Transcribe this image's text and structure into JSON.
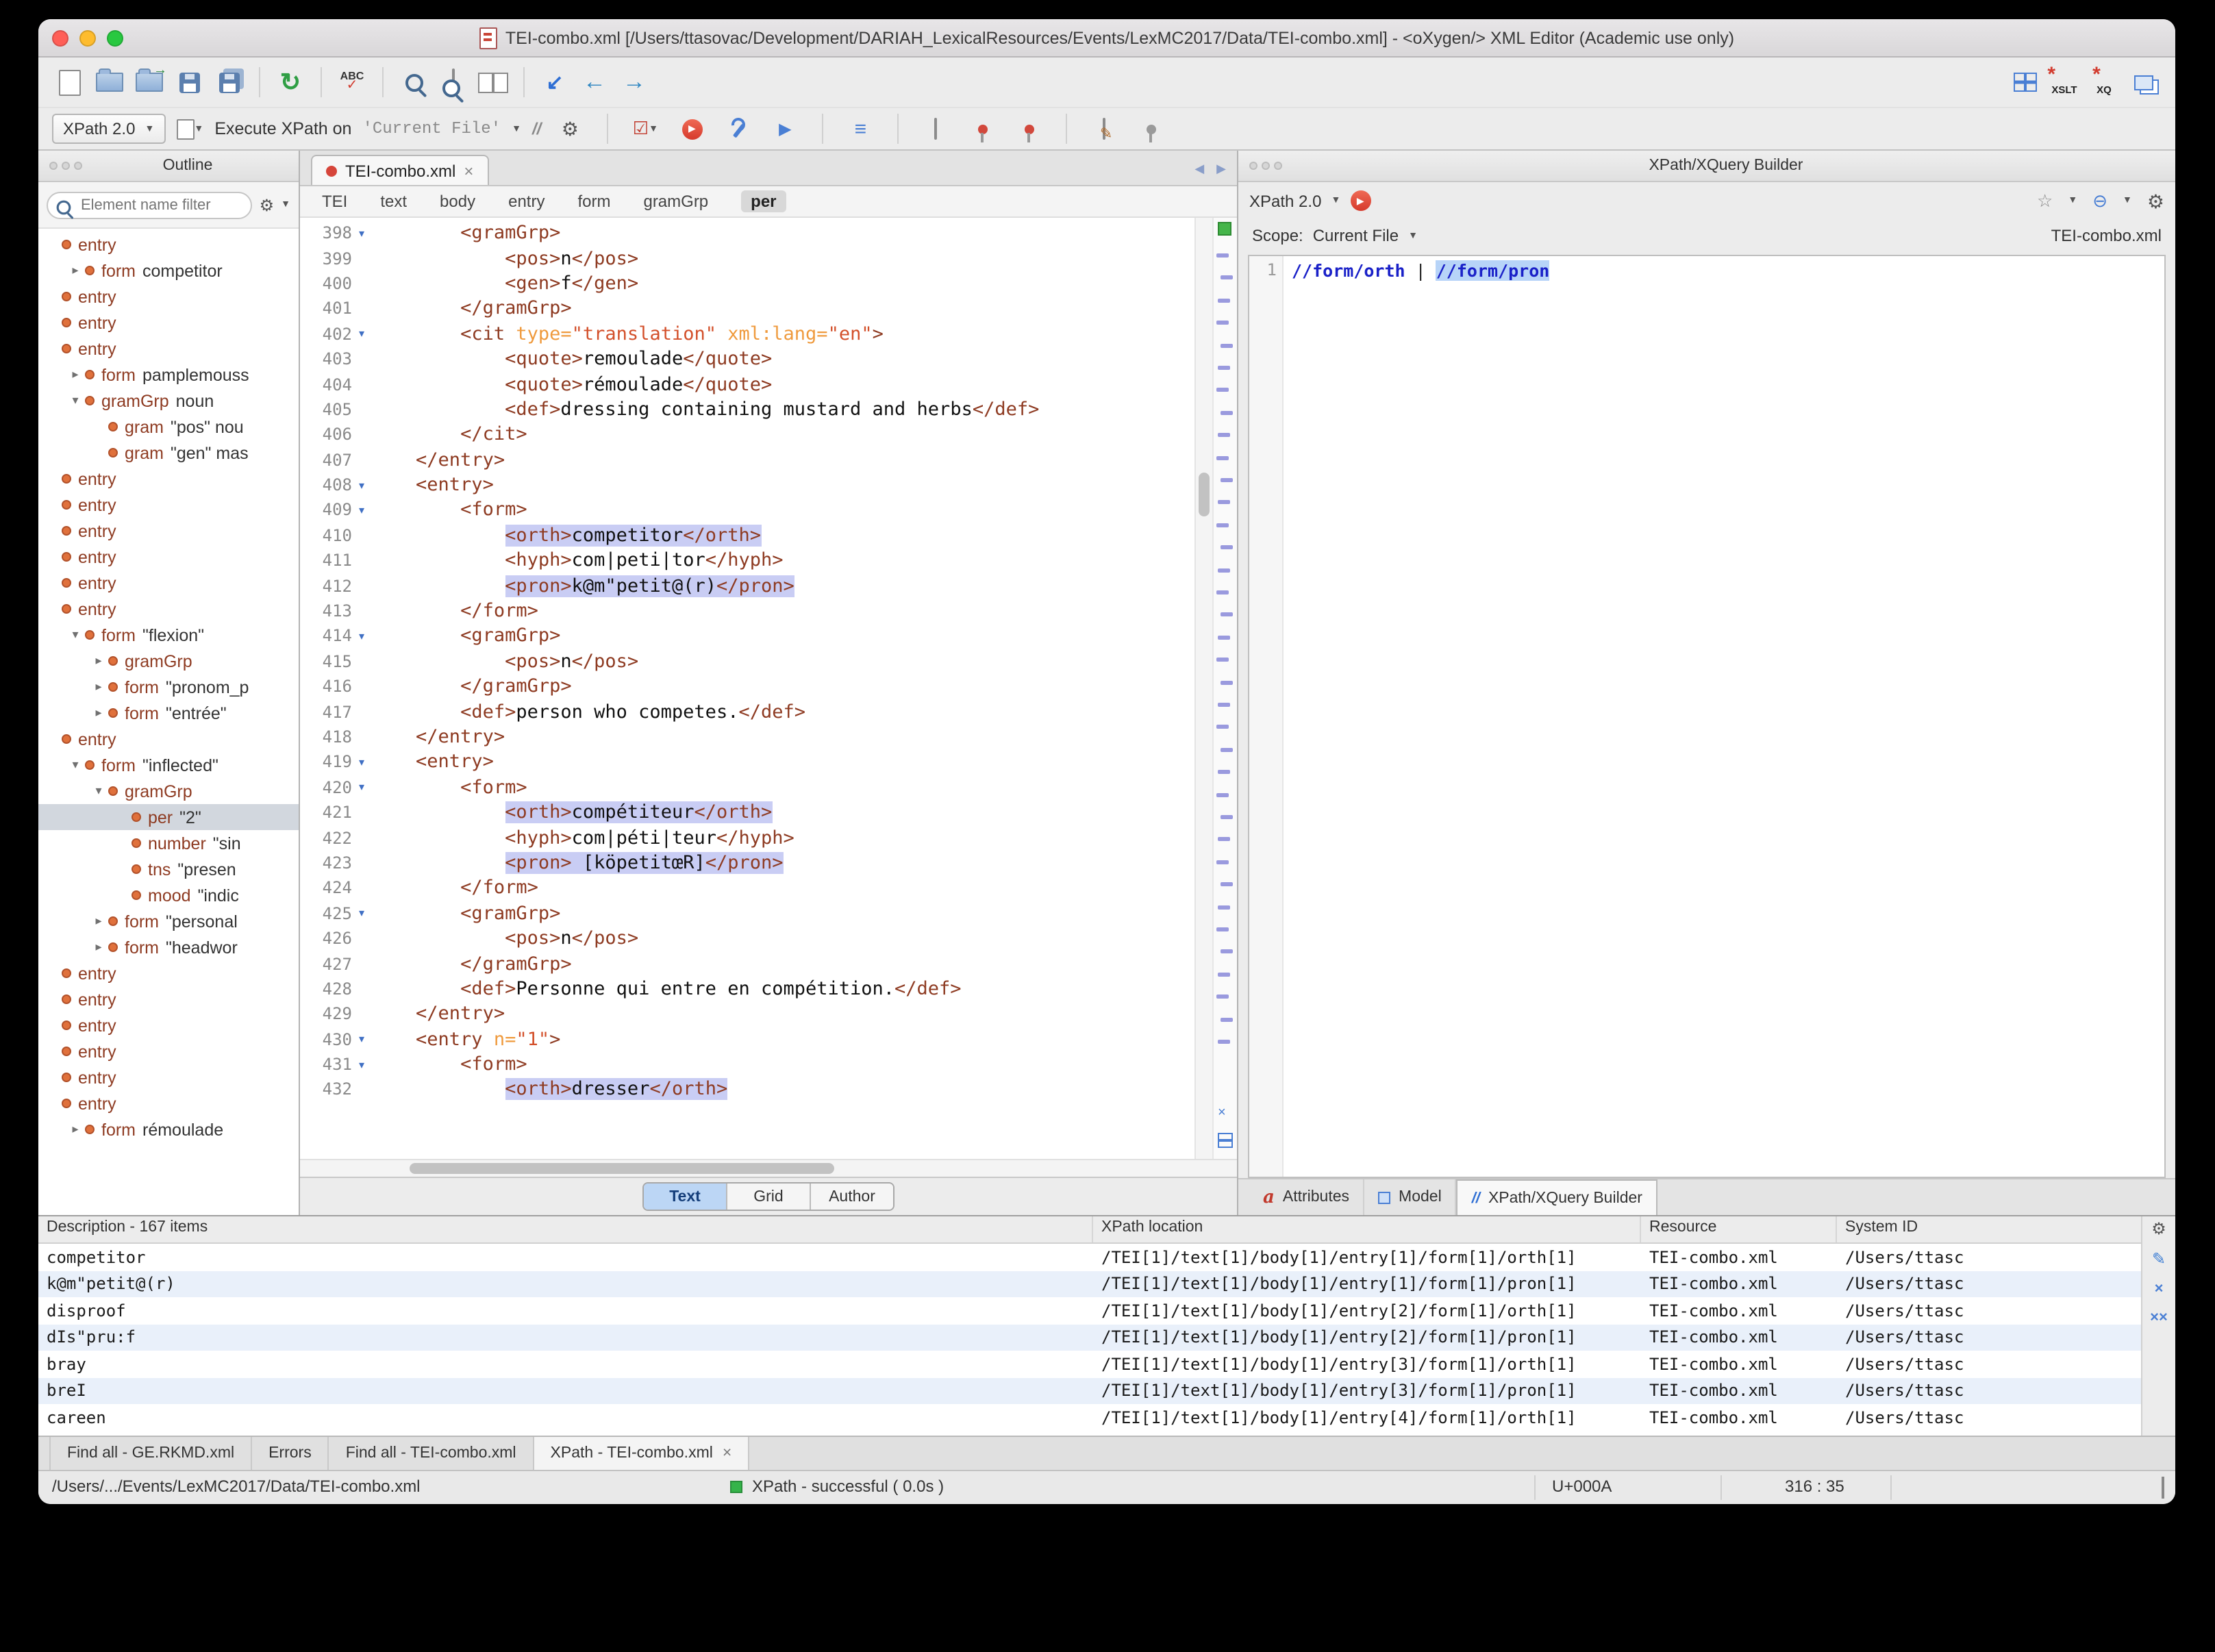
{
  "window": {
    "title": "TEI-combo.xml [/Users/ttasovac/Development/DARIAH_LexicalResources/Events/LexMC2017/Data/TEI-combo.xml] - <oXygen/> XML Editor (Academic use only)"
  },
  "toolbar": {
    "spell": "ABC",
    "xslt": "XSLT",
    "xq": "XQ"
  },
  "xpath_toolbar": {
    "version": "XPath 2.0",
    "execute_label": "Execute XPath on",
    "scope": "'Current File'",
    "xpath_glyph": "//"
  },
  "outline": {
    "title": "Outline",
    "filter_placeholder": "Element name filter",
    "items": [
      {
        "l": 0,
        "a": "",
        "n": "entry",
        "x": ""
      },
      {
        "l": 1,
        "a": "r",
        "n": "form",
        "x": "competitor"
      },
      {
        "l": 0,
        "a": "",
        "n": "entry",
        "x": ""
      },
      {
        "l": 0,
        "a": "",
        "n": "entry",
        "x": ""
      },
      {
        "l": 0,
        "a": "",
        "n": "entry",
        "x": ""
      },
      {
        "l": 1,
        "a": "r",
        "n": "form",
        "x": "pamplemouss"
      },
      {
        "l": 1,
        "a": "d",
        "n": "gramGrp",
        "x": "noun"
      },
      {
        "l": 2,
        "a": "",
        "n": "gram",
        "x": "\"pos\" nou"
      },
      {
        "l": 2,
        "a": "",
        "n": "gram",
        "x": "\"gen\" mas"
      },
      {
        "l": 0,
        "a": "",
        "n": "entry",
        "x": ""
      },
      {
        "l": 0,
        "a": "",
        "n": "entry",
        "x": ""
      },
      {
        "l": 0,
        "a": "",
        "n": "entry",
        "x": ""
      },
      {
        "l": 0,
        "a": "",
        "n": "entry",
        "x": ""
      },
      {
        "l": 0,
        "a": "",
        "n": "entry",
        "x": ""
      },
      {
        "l": 0,
        "a": "",
        "n": "entry",
        "x": ""
      },
      {
        "l": 1,
        "a": "d",
        "n": "form",
        "x": "\"flexion\""
      },
      {
        "l": 2,
        "a": "r",
        "n": "gramGrp",
        "x": ""
      },
      {
        "l": 2,
        "a": "r",
        "n": "form",
        "x": "\"pronom_p"
      },
      {
        "l": 2,
        "a": "r",
        "n": "form",
        "x": "\"entrée\""
      },
      {
        "l": 0,
        "a": "",
        "n": "entry",
        "x": ""
      },
      {
        "l": 1,
        "a": "d",
        "n": "form",
        "x": "\"inflected\""
      },
      {
        "l": 2,
        "a": "d",
        "n": "gramGrp",
        "x": ""
      },
      {
        "l": 3,
        "a": "",
        "n": "per",
        "x": "\"2\"",
        "sel": true
      },
      {
        "l": 3,
        "a": "",
        "n": "number",
        "x": "\"sin"
      },
      {
        "l": 3,
        "a": "",
        "n": "tns",
        "x": "\"presen"
      },
      {
        "l": 3,
        "a": "",
        "n": "mood",
        "x": "\"indic"
      },
      {
        "l": 2,
        "a": "r",
        "n": "form",
        "x": "\"personal"
      },
      {
        "l": 2,
        "a": "r",
        "n": "form",
        "x": "\"headwor"
      },
      {
        "l": 0,
        "a": "",
        "n": "entry",
        "x": ""
      },
      {
        "l": 0,
        "a": "",
        "n": "entry",
        "x": ""
      },
      {
        "l": 0,
        "a": "",
        "n": "entry",
        "x": ""
      },
      {
        "l": 0,
        "a": "",
        "n": "entry",
        "x": ""
      },
      {
        "l": 0,
        "a": "",
        "n": "entry",
        "x": ""
      },
      {
        "l": 0,
        "a": "",
        "n": "entry",
        "x": ""
      },
      {
        "l": 1,
        "a": "r",
        "n": "form",
        "x": "rémoulade"
      }
    ]
  },
  "editor": {
    "tab": "TEI-combo.xml",
    "breadcrumb": [
      "TEI",
      "text",
      "body",
      "entry",
      "form",
      "gramGrp",
      "per"
    ],
    "breadcrumb_active": "per",
    "modes": [
      "Text",
      "Grid",
      "Author"
    ],
    "active_mode": "Text",
    "lines": [
      {
        "n": 398,
        "fold": true,
        "ind": 8,
        "segs": [
          [
            "tag",
            "<gramGrp>"
          ]
        ]
      },
      {
        "n": 399,
        "ind": 12,
        "segs": [
          [
            "tag",
            "<pos>"
          ],
          [
            "txt",
            "n"
          ],
          [
            "tag",
            "</pos>"
          ]
        ]
      },
      {
        "n": 400,
        "ind": 12,
        "segs": [
          [
            "tag",
            "<gen>"
          ],
          [
            "txt",
            "f"
          ],
          [
            "tag",
            "</gen>"
          ]
        ]
      },
      {
        "n": 401,
        "ind": 8,
        "segs": [
          [
            "tag",
            "</gramGrp>"
          ]
        ]
      },
      {
        "n": 402,
        "fold": true,
        "ind": 8,
        "segs": [
          [
            "tag",
            "<cit"
          ],
          [
            "attr",
            " type="
          ],
          [
            "aval",
            "\"translation\""
          ],
          [
            "attr",
            " xml:lang="
          ],
          [
            "aval",
            "\"en\""
          ],
          [
            "tag",
            ">"
          ]
        ]
      },
      {
        "n": 403,
        "ind": 12,
        "segs": [
          [
            "tag",
            "<quote>"
          ],
          [
            "txt",
            "remoulade"
          ],
          [
            "tag",
            "</quote>"
          ]
        ]
      },
      {
        "n": 404,
        "ind": 12,
        "segs": [
          [
            "tag",
            "<quote>"
          ],
          [
            "txt",
            "rémoulade"
          ],
          [
            "tag",
            "</quote>"
          ]
        ]
      },
      {
        "n": 405,
        "ind": 12,
        "segs": [
          [
            "tag",
            "<def>"
          ],
          [
            "txt",
            "dressing containing mustard and herbs"
          ],
          [
            "tag",
            "</def>"
          ]
        ]
      },
      {
        "n": 406,
        "ind": 8,
        "segs": [
          [
            "tag",
            "</cit>"
          ]
        ]
      },
      {
        "n": 407,
        "ind": 4,
        "segs": [
          [
            "tag",
            "</entry>"
          ]
        ]
      },
      {
        "n": 408,
        "fold": true,
        "ind": 4,
        "segs": [
          [
            "tag",
            "<entry>"
          ]
        ]
      },
      {
        "n": 409,
        "fold": true,
        "ind": 8,
        "segs": [
          [
            "tag",
            "<form>"
          ]
        ]
      },
      {
        "n": 410,
        "ind": 12,
        "segs": [
          [
            "tag",
            "<orth>",
            1
          ],
          [
            "txt",
            "competitor",
            1
          ],
          [
            "tag",
            "</orth>",
            1
          ]
        ]
      },
      {
        "n": 411,
        "ind": 12,
        "segs": [
          [
            "tag",
            "<hyph>"
          ],
          [
            "txt",
            "com|peti|tor"
          ],
          [
            "tag",
            "</hyph>"
          ]
        ]
      },
      {
        "n": 412,
        "ind": 12,
        "segs": [
          [
            "tag",
            "<pron>",
            1
          ],
          [
            "txt",
            "k@m\"petit@(r)",
            1
          ],
          [
            "tag",
            "</pron>",
            1
          ]
        ]
      },
      {
        "n": 413,
        "ind": 8,
        "segs": [
          [
            "tag",
            "</form>"
          ]
        ]
      },
      {
        "n": 414,
        "fold": true,
        "ind": 8,
        "segs": [
          [
            "tag",
            "<gramGrp>"
          ]
        ]
      },
      {
        "n": 415,
        "ind": 12,
        "segs": [
          [
            "tag",
            "<pos>"
          ],
          [
            "txt",
            "n"
          ],
          [
            "tag",
            "</pos>"
          ]
        ]
      },
      {
        "n": 416,
        "ind": 8,
        "segs": [
          [
            "tag",
            "</gramGrp>"
          ]
        ]
      },
      {
        "n": 417,
        "ind": 8,
        "segs": [
          [
            "tag",
            "<def>"
          ],
          [
            "txt",
            "person who competes."
          ],
          [
            "tag",
            "</def>"
          ]
        ]
      },
      {
        "n": 418,
        "ind": 4,
        "segs": [
          [
            "tag",
            "</entry>"
          ]
        ]
      },
      {
        "n": 419,
        "fold": true,
        "ind": 4,
        "segs": [
          [
            "tag",
            "<entry>"
          ]
        ]
      },
      {
        "n": 420,
        "fold": true,
        "ind": 8,
        "segs": [
          [
            "tag",
            "<form>"
          ]
        ]
      },
      {
        "n": 421,
        "ind": 12,
        "segs": [
          [
            "tag",
            "<orth>",
            1
          ],
          [
            "txt",
            "compétiteur",
            1
          ],
          [
            "tag",
            "</orth>",
            1
          ]
        ]
      },
      {
        "n": 422,
        "ind": 12,
        "segs": [
          [
            "tag",
            "<hyph>"
          ],
          [
            "txt",
            "com|péti|teur"
          ],
          [
            "tag",
            "</hyph>"
          ]
        ]
      },
      {
        "n": 423,
        "ind": 12,
        "segs": [
          [
            "tag",
            "<pron>",
            1
          ],
          [
            "txt",
            " [köpetitœR]",
            1
          ],
          [
            "tag",
            "</pron>",
            1
          ]
        ]
      },
      {
        "n": 424,
        "ind": 8,
        "segs": [
          [
            "tag",
            "</form>"
          ]
        ]
      },
      {
        "n": 425,
        "fold": true,
        "ind": 8,
        "segs": [
          [
            "tag",
            "<gramGrp>"
          ]
        ]
      },
      {
        "n": 426,
        "ind": 12,
        "segs": [
          [
            "tag",
            "<pos>"
          ],
          [
            "txt",
            "n"
          ],
          [
            "tag",
            "</pos>"
          ]
        ]
      },
      {
        "n": 427,
        "ind": 8,
        "segs": [
          [
            "tag",
            "</gramGrp>"
          ]
        ]
      },
      {
        "n": 428,
        "ind": 8,
        "segs": [
          [
            "tag",
            "<def>"
          ],
          [
            "txt",
            "Personne qui entre en compétition."
          ],
          [
            "tag",
            "</def>"
          ]
        ]
      },
      {
        "n": 429,
        "ind": 4,
        "segs": [
          [
            "tag",
            "</entry>"
          ]
        ]
      },
      {
        "n": 430,
        "fold": true,
        "ind": 4,
        "segs": [
          [
            "tag",
            "<entry"
          ],
          [
            "attr",
            " n="
          ],
          [
            "aval",
            "\"1\""
          ],
          [
            "tag",
            ">"
          ]
        ]
      },
      {
        "n": 431,
        "fold": true,
        "ind": 8,
        "segs": [
          [
            "tag",
            "<form>"
          ]
        ]
      },
      {
        "n": 432,
        "ind": 12,
        "segs": [
          [
            "tag",
            "<orth>",
            1
          ],
          [
            "txt",
            "dresser",
            1
          ],
          [
            "tag",
            "</orth>",
            1
          ]
        ]
      }
    ]
  },
  "builder": {
    "title": "XPath/XQuery Builder",
    "version": "XPath 2.0",
    "scope_label": "Scope:",
    "scope_value": "Current File",
    "file": "TEI-combo.xml",
    "line_number": "1",
    "expression": [
      {
        "text": "//form/orth",
        "cls": "x"
      },
      {
        "text": " | ",
        "cls": "p"
      },
      {
        "text": "//form/pron",
        "cls": "x s"
      }
    ],
    "tabs": [
      {
        "label": "Attributes",
        "icon": "a"
      },
      {
        "label": "Model",
        "icon": ""
      },
      {
        "label": "XPath/XQuery Builder",
        "icon": "//",
        "active": true
      }
    ]
  },
  "results": {
    "columns": [
      "Description - 167 items",
      "XPath location",
      "Resource",
      "System ID"
    ],
    "rows": [
      [
        "competitor",
        "/TEI[1]/text[1]/body[1]/entry[1]/form[1]/orth[1]",
        "TEI-combo.xml",
        "/Users/ttasc"
      ],
      [
        "k@m\"petit@(r)",
        "/TEI[1]/text[1]/body[1]/entry[1]/form[1]/pron[1]",
        "TEI-combo.xml",
        "/Users/ttasc"
      ],
      [
        "disproof",
        "/TEI[1]/text[1]/body[1]/entry[2]/form[1]/orth[1]",
        "TEI-combo.xml",
        "/Users/ttasc"
      ],
      [
        "dIs\"pru:f",
        "/TEI[1]/text[1]/body[1]/entry[2]/form[1]/pron[1]",
        "TEI-combo.xml",
        "/Users/ttasc"
      ],
      [
        "bray",
        "/TEI[1]/text[1]/body[1]/entry[3]/form[1]/orth[1]",
        "TEI-combo.xml",
        "/Users/ttasc"
      ],
      [
        "breI",
        "/TEI[1]/text[1]/body[1]/entry[3]/form[1]/pron[1]",
        "TEI-combo.xml",
        "/Users/ttasc"
      ],
      [
        "careen",
        "/TEI[1]/text[1]/body[1]/entry[4]/form[1]/orth[1]",
        "TEI-combo.xml",
        "/Users/ttasc"
      ]
    ]
  },
  "bottom_tabs": [
    {
      "label": "Find all - GE.RKMD.xml"
    },
    {
      "label": "Errors"
    },
    {
      "label": "Find all - TEI-combo.xml"
    },
    {
      "label": "XPath - TEI-combo.xml",
      "active": true,
      "closable": true
    }
  ],
  "status": {
    "path": "/Users/.../Events/LexMC2017/Data/TEI-combo.xml",
    "message": "XPath - successful ( 0.0s )",
    "unicode": "U+000A",
    "position": "316 : 35"
  }
}
